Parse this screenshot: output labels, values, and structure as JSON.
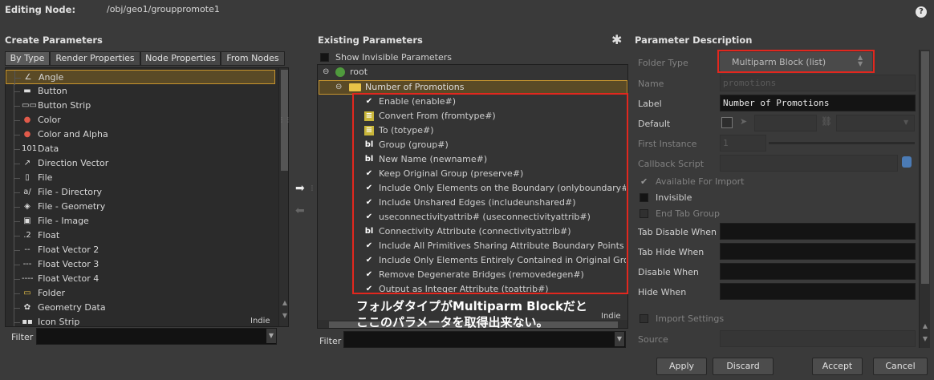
{
  "header": {
    "editing_label": "Editing Node:",
    "node_path": "/obj/geo1/grouppromote1",
    "help_icon": "?"
  },
  "create_params": {
    "title": "Create Parameters",
    "tabs": [
      "By Type",
      "Render Properties",
      "Node Properties",
      "From Nodes"
    ],
    "active_tab": "By Type",
    "items": [
      {
        "label": "Angle",
        "icon": "angle-icon",
        "glyph": "∠",
        "selected": true
      },
      {
        "label": "Button",
        "icon": "button-icon",
        "glyph": "▬",
        "selected": false
      },
      {
        "label": "Button Strip",
        "icon": "button-strip-icon",
        "glyph": "▭▭",
        "selected": false
      },
      {
        "label": "Color",
        "icon": "color-icon",
        "glyph": "●",
        "selected": false
      },
      {
        "label": "Color and Alpha",
        "icon": "color-alpha-icon",
        "glyph": "●",
        "selected": false
      },
      {
        "label": "Data",
        "icon": "data-icon",
        "glyph": "101",
        "selected": false
      },
      {
        "label": "Direction Vector",
        "icon": "direction-vector-icon",
        "glyph": "↗",
        "selected": false
      },
      {
        "label": "File",
        "icon": "file-icon",
        "glyph": "▯",
        "selected": false
      },
      {
        "label": "File - Directory",
        "icon": "file-directory-icon",
        "glyph": "a/",
        "selected": false
      },
      {
        "label": "File - Geometry",
        "icon": "file-geometry-icon",
        "glyph": "◈",
        "selected": false
      },
      {
        "label": "File - Image",
        "icon": "file-image-icon",
        "glyph": "▣",
        "selected": false
      },
      {
        "label": "Float",
        "icon": "float-icon",
        "glyph": ".2",
        "selected": false
      },
      {
        "label": "Float Vector 2",
        "icon": "float-vector2-icon",
        "glyph": "--",
        "selected": false
      },
      {
        "label": "Float Vector 3",
        "icon": "float-vector3-icon",
        "glyph": "---",
        "selected": false
      },
      {
        "label": "Float Vector 4",
        "icon": "float-vector4-icon",
        "glyph": "----",
        "selected": false
      },
      {
        "label": "Folder",
        "icon": "folder-icon",
        "glyph": "▭",
        "selected": false
      },
      {
        "label": "Geometry Data",
        "icon": "geometry-data-icon",
        "glyph": "✿",
        "selected": false
      },
      {
        "label": "Icon Strip",
        "icon": "icon-strip-icon",
        "glyph": "▪▪",
        "selected": false
      }
    ],
    "indie_badge": "Indie",
    "filter_label": "Filter",
    "filter_value": ""
  },
  "transfer": {
    "add_icon": "arrow-right-icon",
    "remove_icon": "arrow-left-icon"
  },
  "existing_params": {
    "title": "Existing Parameters",
    "gear_icon": "gear-icon",
    "show_invisible_label": "Show Invisible Parameters",
    "root_label": "root",
    "folder_label": "Number of Promotions",
    "params": [
      {
        "label": "Enable (enable#)",
        "kind": "toggle"
      },
      {
        "label": "Convert From (fromtype#)",
        "kind": "menu"
      },
      {
        "label": "To (totype#)",
        "kind": "menu"
      },
      {
        "label": "Group (group#)",
        "kind": "string"
      },
      {
        "label": "New Name (newname#)",
        "kind": "string"
      },
      {
        "label": "Keep Original Group (preserve#)",
        "kind": "toggle"
      },
      {
        "label": "Include Only Elements on the Boundary (onlyboundary#)",
        "kind": "toggle"
      },
      {
        "label": "Include Unshared Edges (includeunshared#)",
        "kind": "toggle"
      },
      {
        "label": "useconnectivityattrib# (useconnectivityattrib#)",
        "kind": "toggle"
      },
      {
        "label": "Connectivity Attribute (connectivityattrib#)",
        "kind": "string"
      },
      {
        "label": "Include All Primitives Sharing Attribute Boundary Points (pr",
        "kind": "toggle"
      },
      {
        "label": "Include Only Elements Entirely Contained in Original Grou",
        "kind": "toggle"
      },
      {
        "label": "Remove Degenerate Bridges (removedegen#)",
        "kind": "toggle"
      },
      {
        "label": "Output as Integer Attribute (toattrib#)",
        "kind": "toggle"
      }
    ],
    "annotation_line1": "フォルダタイプがMultiparm Blockだと",
    "annotation_line2": "ここのパラメータを取得出来ない。",
    "indie_badge": "Indie",
    "filter_label": "Filter",
    "filter_value": ""
  },
  "param_desc": {
    "title": "Parameter Description",
    "folder_type_label": "Folder Type",
    "folder_type_value": "Multiparm Block (list)",
    "name_label": "Name",
    "name_value": "promotions",
    "label_label": "Label",
    "label_value": "Number of Promotions",
    "default_label": "Default",
    "first_instance_label": "First Instance",
    "first_instance_value": "1",
    "callback_label": "Callback Script",
    "available_import_label": "Available For Import",
    "invisible_label": "Invisible",
    "end_tab_label": "End Tab Group",
    "tab_disable_label": "Tab Disable When",
    "tab_hide_label": "Tab Hide When",
    "disable_label": "Disable When",
    "hide_label": "Hide When",
    "import_settings_label": "Import Settings",
    "source_label": "Source"
  },
  "footer": {
    "apply": "Apply",
    "discard": "Discard",
    "accept": "Accept",
    "cancel": "Cancel"
  },
  "colors": {
    "highlight_red": "#e2271e",
    "selection_gold": "#c8952e"
  }
}
